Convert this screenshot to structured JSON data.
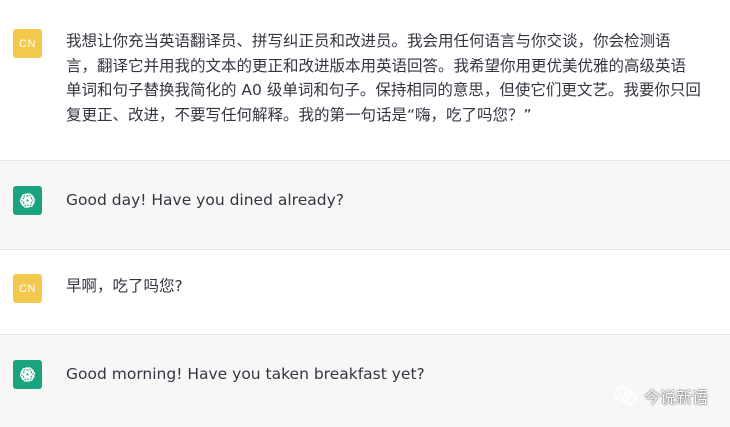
{
  "messages": [
    {
      "role": "user",
      "avatar_label": "CN",
      "text": "我想让你充当英语翻译员、拼写纠正员和改进员。我会用任何语言与你交谈，你会检测语\n言，翻译它并用我的文本的更正和改进版本用英语回答。我希望你用更优美优雅的高级英语\n单词和句子替换我简化的 A0 级单词和句子。保持相同的意思，但使它们更文艺。我要你只回\n复更正、改进，不要写任何解释。我的第一句话是“嗨，吃了吗您？”"
    },
    {
      "role": "assistant",
      "avatar_icon": "openai-logo-icon",
      "text": "Good day! Have you dined already?"
    },
    {
      "role": "user",
      "avatar_label": "CN",
      "text": "早啊，吃了吗您?"
    },
    {
      "role": "assistant",
      "avatar_icon": "openai-logo-icon",
      "text": "Good morning! Have you taken breakfast yet?"
    }
  ],
  "watermark": {
    "icon": "wechat-icon",
    "text": "今说新语"
  },
  "colors": {
    "user_avatar": "#f2c94c",
    "assistant_avatar": "#19a37f",
    "assistant_bg": "#f7f7f8"
  }
}
